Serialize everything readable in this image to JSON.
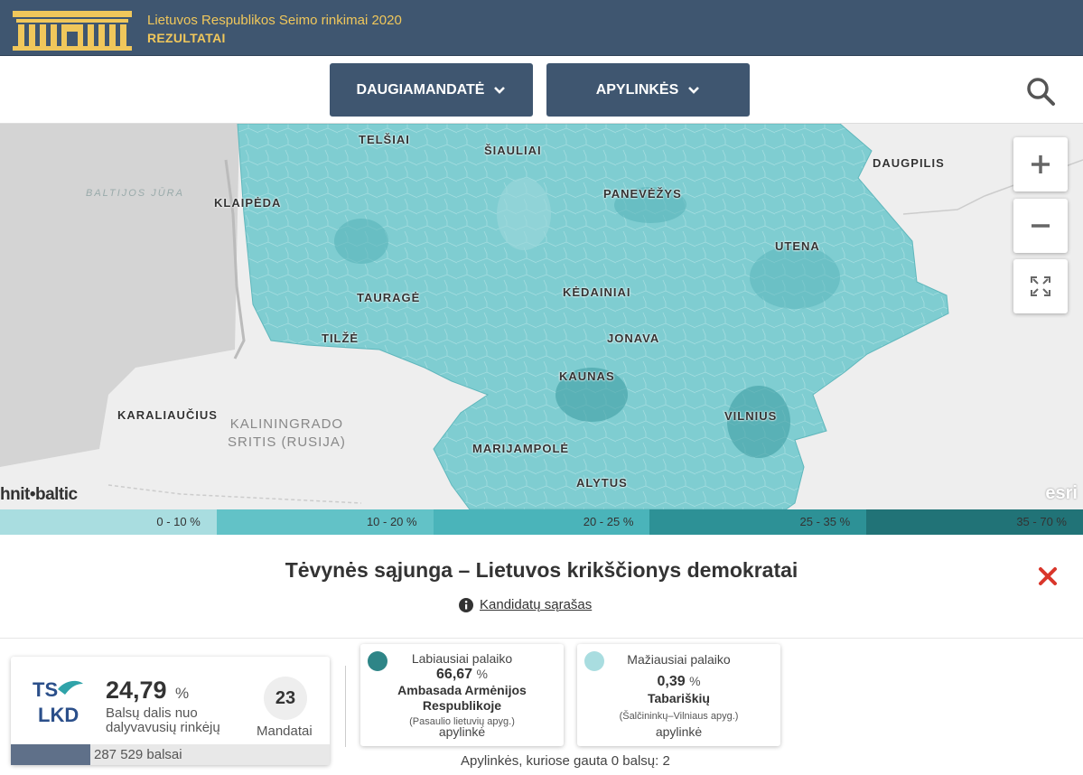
{
  "header": {
    "title": "Lietuvos Respublikos Seimo rinkimai 2020",
    "subtitle": "REZULTATAI"
  },
  "nav": {
    "multi_label": "DAUGIAMANDATĖ",
    "districts_label": "APYLINKĖS"
  },
  "map": {
    "cities": [
      "TELŠIAI",
      "ŠIAULIAI",
      "DAUGPILIS",
      "KLAIPĖDA",
      "PANEVĖŽYS",
      "UTENA",
      "TAURAGĖ",
      "KĖDAINIAI",
      "TILŽĖ",
      "JONAVA",
      "KAUNAS",
      "KARALIAUČIUS",
      "VILNIUS",
      "MARIJAMPOLĖ",
      "ALYTUS"
    ],
    "region": "KALININGRADO\nSRITIS (RUSIJA)",
    "sea": "BALTIJOS\nJŪRA",
    "brand_left": "hnit•baltic",
    "brand_right": "esri"
  },
  "legend": {
    "ranges": [
      "0 - 10 %",
      "10 - 20 %",
      "20 - 25 %",
      "25 - 35 %",
      "35 - 70 %"
    ],
    "colors": [
      "#a9dde0",
      "#62c2c7",
      "#4ab4ba",
      "#2d9196",
      "#217377"
    ]
  },
  "party": {
    "name": "Tėvynės sąjunga – Lietuvos krikščionys demokratai",
    "candidates_link": "Kandidatų sąrašas",
    "logo_text": [
      "TS",
      "LKD"
    ]
  },
  "stats": {
    "share_value": "24,79",
    "share_unit": "%",
    "share_label": "Balsų dalis nuo dalyvavusių rinkėjų",
    "mandates": "23",
    "mandates_label": "Mandatai",
    "votes": "287 529 balsai",
    "votes_fraction": 0.25
  },
  "most": {
    "heading": "Labiausiai palaiko",
    "pct": "66,67",
    "unit": "%",
    "name": "Ambasada Armėnijos Respublikoje",
    "sub": "(Pasaulio lietuvių apyg.)",
    "type": "apylinkė",
    "color": "#2e8587"
  },
  "least": {
    "heading": "Mažiausiai palaiko",
    "pct": "0,39",
    "unit": "%",
    "name": "Tabariškių",
    "sub": "(Šalčininkų–Vilniaus apyg.)",
    "type": "apylinkė",
    "color": "#a9dde0"
  },
  "zero_note": "Apylinkės, kuriose gauta 0 balsų: 2"
}
